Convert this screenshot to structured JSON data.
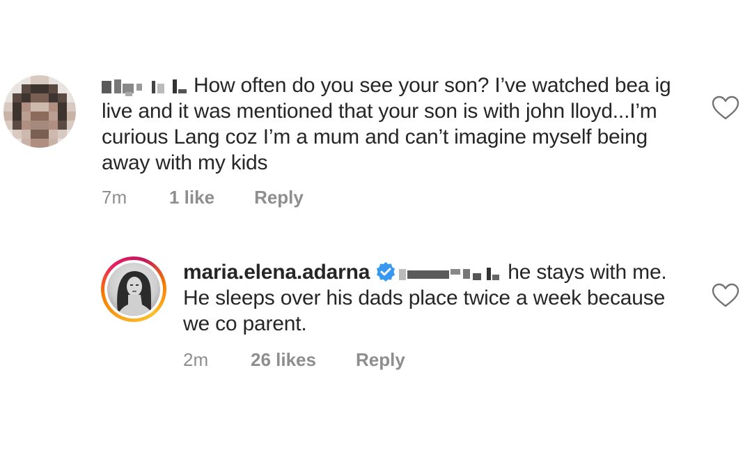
{
  "comments": [
    {
      "avatar_icon": "pixelated-avatar",
      "username_redacted": true,
      "text": "How often do you see your son? I’ve watched bea ig live and it was mentioned that your son is with john lloyd...I’m curious Lang coz I’m a mum and can’t imagine myself being away with my kids",
      "time": "7m",
      "likes": "1 like",
      "reply_label": "Reply",
      "like_icon": "heart-icon"
    },
    {
      "avatar_icon": "story-ring-avatar",
      "username": "maria.elena.adarna",
      "verified": true,
      "mention_redacted": true,
      "text": "he stays with me. He sleeps over his dads place twice a week because we co parent.",
      "time": "2m",
      "likes": "26 likes",
      "reply_label": "Reply",
      "like_icon": "heart-icon"
    }
  ],
  "colors": {
    "text": "#262626",
    "meta": "#8e8e8e",
    "verified_badge": "#3897f0"
  }
}
